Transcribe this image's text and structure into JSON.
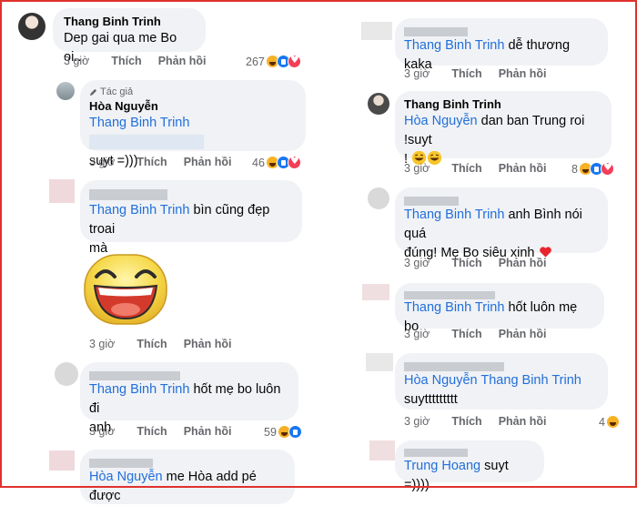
{
  "labels": {
    "like": "Thích",
    "reply": "Phản hồi",
    "author_badge": "Tác giả"
  },
  "left": {
    "c1": {
      "name": "Thang Binh Trinh",
      "text": "Dep gai qua me Bo oi...",
      "time": "3 giờ",
      "count": "267"
    },
    "c2": {
      "name": "Hòa Nguyễn",
      "tag": "Thang Binh Trinh",
      "text": "suyt =)))",
      "time": "3 giờ",
      "count": "46"
    },
    "c3": {
      "tag": "Thang Binh Trinh",
      "text": "bìn cũng đẹp troai",
      "text2": "mà",
      "time": "3 giờ"
    },
    "c4": {
      "time": "3 giờ"
    },
    "c5": {
      "tag": "Thang Binh Trinh",
      "text": "hốt mẹ bo luôn đi",
      "text2": "anh",
      "time": "3 giờ",
      "count": "59"
    },
    "c6": {
      "tag": "Hòa Nguyễn",
      "text": "me Hòa add pé được"
    }
  },
  "right": {
    "c1": {
      "tag": "Thang Binh Trinh",
      "text": "dễ thương kaka",
      "time": "3 giờ"
    },
    "c2": {
      "name": "Thang Binh Trinh",
      "tag": "Hòa Nguyễn",
      "text": "dan ban Trung roi !suyt",
      "text2": "!",
      "time": "3 giờ",
      "count": "8"
    },
    "c3": {
      "tag": "Thang Binh Trinh",
      "text": "anh Bình nói quá",
      "text2": "đúng! Mẹ Bo siêu xinh",
      "time": "3 giờ"
    },
    "c4": {
      "tag": "Thang Binh Trinh",
      "text": "hốt luôn mẹ bo",
      "time": "3 giờ"
    },
    "c5": {
      "tag": "Hòa Nguyễn",
      "tag2": "Thang Binh Trinh",
      "text": "suyttttttttt",
      "time": "3 giờ",
      "count": "4"
    },
    "c6": {
      "tag": "Trung Hoang",
      "text": "suyt =))))"
    }
  },
  "icons": [
    "haha-reaction-icon",
    "like-reaction-icon",
    "love-reaction-icon",
    "pencil-icon",
    "heart-emoji-icon",
    "laughing-emoji-icon"
  ],
  "colors": {
    "tag_blue": "#216fdb",
    "bubble": "#f0f2f5",
    "frame_red": "#e0322d"
  }
}
